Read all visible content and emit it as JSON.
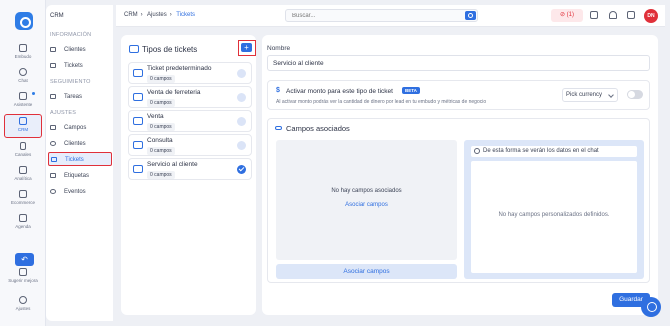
{
  "rail": {
    "items": [
      {
        "label": "Embudo",
        "icon": "funnel-icon"
      },
      {
        "label": "Chat",
        "icon": "chat-icon"
      },
      {
        "label": "Asistente",
        "icon": "assistant-icon"
      },
      {
        "label": "CRM",
        "icon": "crm-icon"
      },
      {
        "label": "Canales",
        "icon": "phone-icon"
      },
      {
        "label": "Analítica",
        "icon": "chart-icon"
      },
      {
        "label": "Ecommerce",
        "icon": "cart-icon"
      },
      {
        "label": "Agenda",
        "icon": "calendar-icon"
      },
      {
        "label": "Sugerir mejora",
        "icon": "bulb-icon"
      },
      {
        "label": "Ajustes",
        "icon": "gear-icon"
      }
    ]
  },
  "submenu": {
    "title": "CRM",
    "sections": [
      "Información",
      "Seguimiento",
      "Ajustes"
    ],
    "info_items": [
      "Clientes",
      "Tickets"
    ],
    "seg_items": [
      "Tareas"
    ],
    "settings_items": [
      "Campos",
      "Clientes",
      "Tickets",
      "Etiquetas",
      "Eventos"
    ]
  },
  "topbar": {
    "breadcrumb": [
      "CRM",
      "Ajustes",
      "Tickets"
    ],
    "search_placeholder": "Buscar...",
    "alert_label": "(1)",
    "avatar_initials": "DN"
  },
  "ticket_types": {
    "title": "Tipos de tickets",
    "add_label": "+",
    "items": [
      {
        "name": "Ticket predeterminado",
        "count": "0 campos",
        "selected": false
      },
      {
        "name": "Venta de ferreteria",
        "count": "0 campos",
        "selected": false
      },
      {
        "name": "Venta",
        "count": "0 campos",
        "selected": false
      },
      {
        "name": "Consulta",
        "count": "0 campos",
        "selected": false
      },
      {
        "name": "Servicio al cliente",
        "count": "0 campos",
        "selected": true
      }
    ]
  },
  "detail": {
    "name_label": "Nombre",
    "name_value": "Servicio al cliente",
    "amount": {
      "symbol": "$",
      "title": "Activar monto para este tipo de ticket",
      "badge": "BETA",
      "desc": "Al activar monto podrás ver la cantidad de dinero por lead en tu embudo y métricas de negocio",
      "currency": "Pick currency",
      "enabled": false
    },
    "fields": {
      "title": "Campos asociados",
      "empty_text": "No hay campos asociados",
      "empty_link": "Asociar campos",
      "assoc_button": "Asociar campos",
      "preview_title": "De esta forma se verán los datos en el chat",
      "preview_empty": "No hay campos personalizados definidos."
    },
    "save_label": "Guardar"
  },
  "colors": {
    "accent": "#2f6fe0",
    "highlight": "#e0303a",
    "background": "#eef0f5"
  }
}
